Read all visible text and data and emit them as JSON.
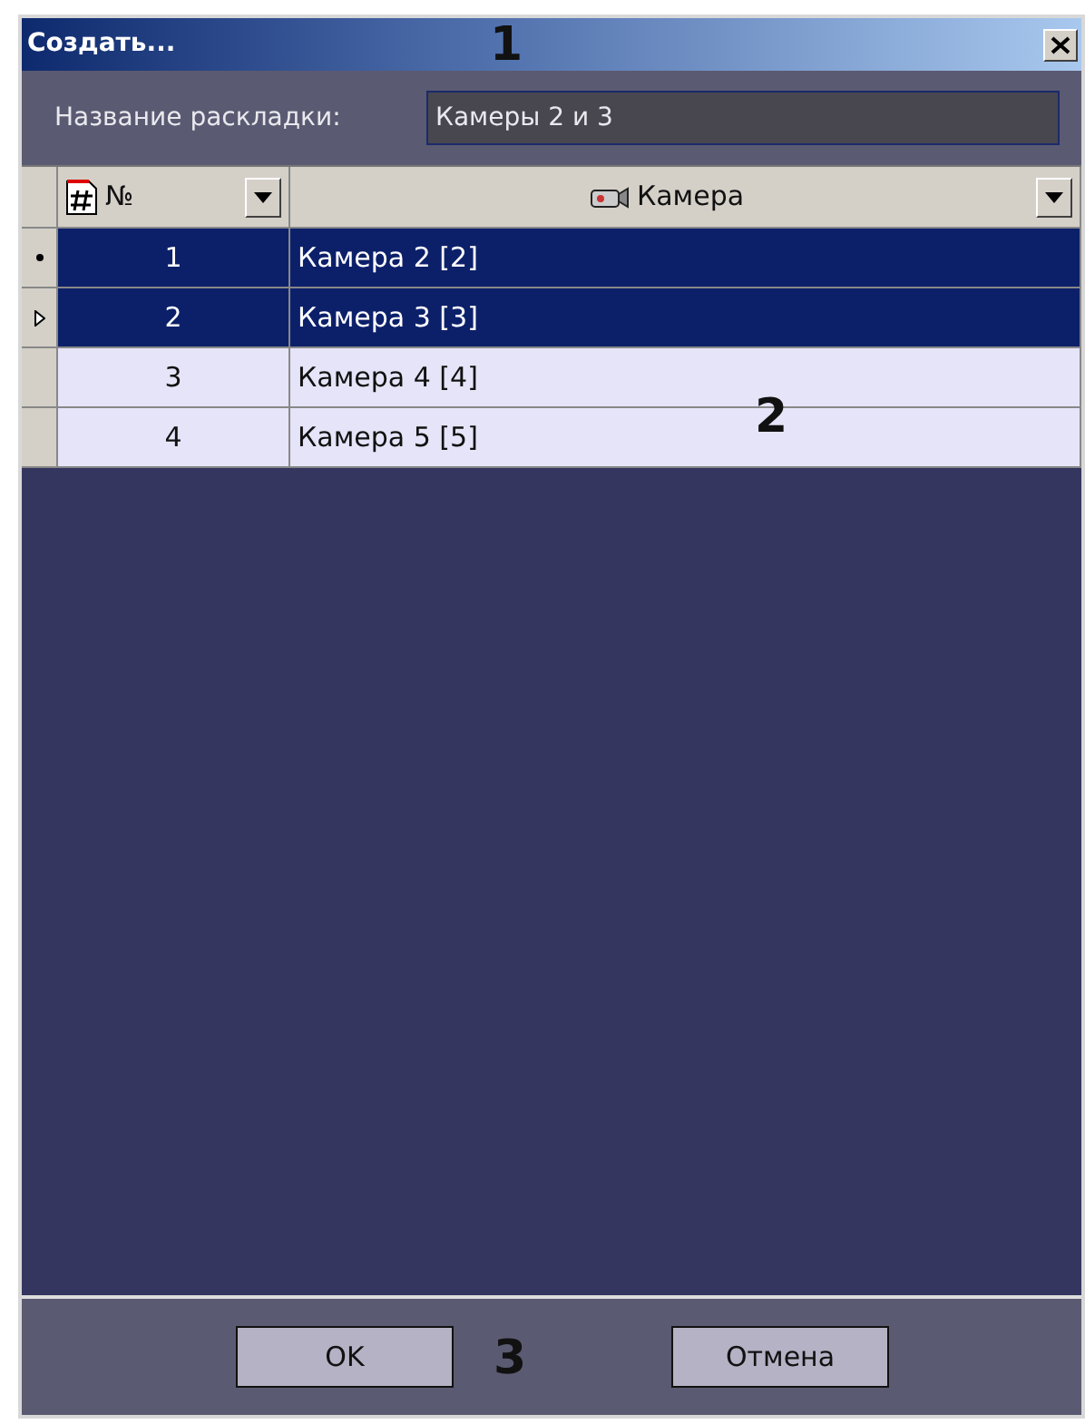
{
  "window": {
    "title": "Создать..."
  },
  "layout_name": {
    "label": "Название раскладки:",
    "value": "Камеры 2 и 3"
  },
  "table": {
    "columns": [
      {
        "label": "№",
        "kind": "number"
      },
      {
        "label": "Камера",
        "kind": "camera"
      }
    ],
    "rows": [
      {
        "number": "1",
        "camera": "Камера 2 [2]",
        "selected": true,
        "current": true,
        "editing": false
      },
      {
        "number": "2",
        "camera": "Камера 3 [3]",
        "selected": true,
        "current": false,
        "editing": true
      },
      {
        "number": "3",
        "camera": "Камера 4 [4]",
        "selected": false,
        "current": false,
        "editing": false
      },
      {
        "number": "4",
        "camera": "Камера 5 [5]",
        "selected": false,
        "current": false,
        "editing": false
      }
    ]
  },
  "buttons": [
    "OK",
    "Отмена"
  ],
  "callouts": [
    {
      "label": "1"
    },
    {
      "label": "2"
    },
    {
      "label": "3"
    }
  ]
}
